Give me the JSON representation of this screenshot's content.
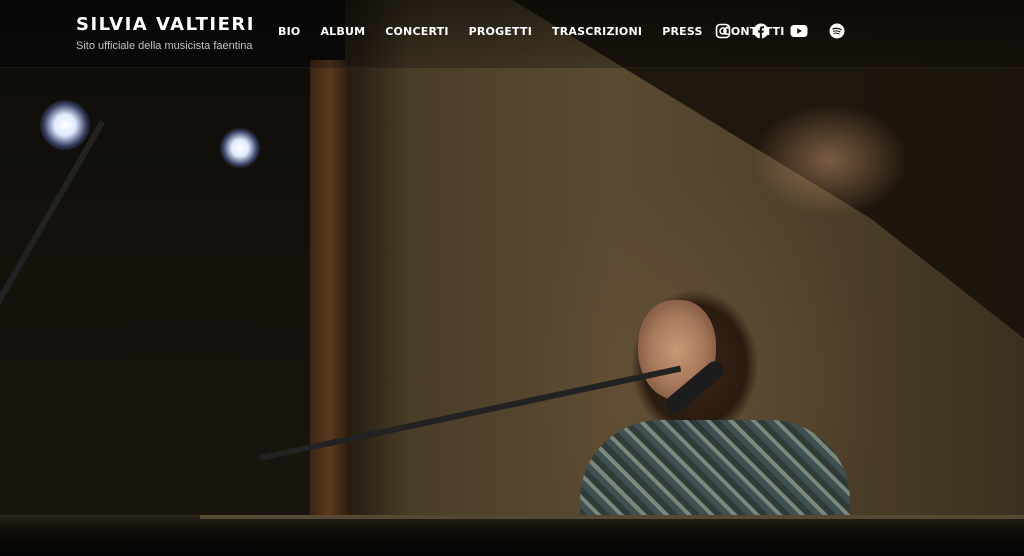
{
  "site": {
    "title": "SILVIA VALTIERI",
    "tagline": "Sito ufficiale della musicista faentina"
  },
  "nav": {
    "items": [
      {
        "label": "BIO"
      },
      {
        "label": "ALBUM"
      },
      {
        "label": "CONCERTI"
      },
      {
        "label": "PROGETTI"
      },
      {
        "label": "TRASCRIZIONI"
      },
      {
        "label": "PRESS"
      },
      {
        "label": "CONTATTI"
      }
    ]
  },
  "social": {
    "icons": [
      "instagram-icon",
      "facebook-icon",
      "youtube-icon",
      "spotify-icon"
    ]
  },
  "colors": {
    "header_text": "#ffffff",
    "header_overlay": "rgba(0,0,0,0.55)"
  }
}
